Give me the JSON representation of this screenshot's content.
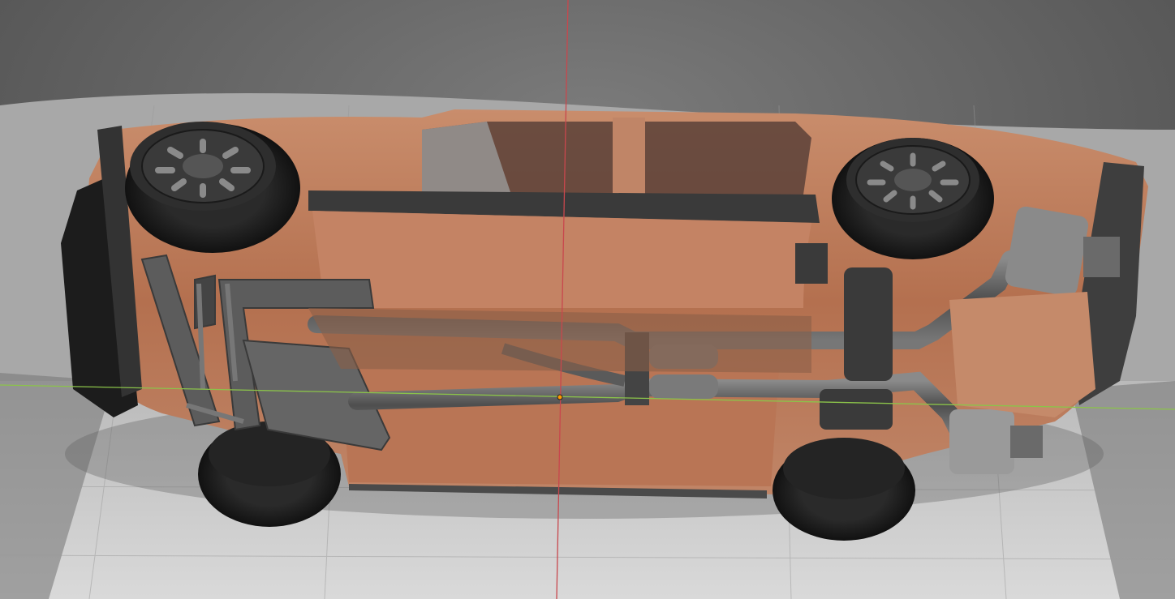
{
  "viewport": {
    "mode": "rendered",
    "subject": "car-underside",
    "colors": {
      "background_top": "#6b6b6b",
      "floor": "#d2d2d2",
      "car_body": "#b97a5a",
      "body_highlight": "#e0a789",
      "tire": "#1c1c1c",
      "rim": "#4a4a4a",
      "frame": "#5c5c5c",
      "exhaust": "#6e6e6e",
      "x_axis": "#c8474d",
      "y_axis": "#8bc34a",
      "origin": "#ff9900"
    },
    "axes": {
      "x_axis_visible": true,
      "y_axis_visible": true
    }
  }
}
